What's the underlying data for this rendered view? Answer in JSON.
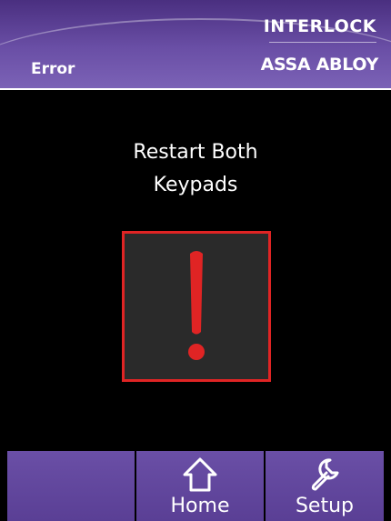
{
  "header": {
    "screen_title": "Error",
    "brand_top": "INTERLOCK",
    "brand_bottom": "ASSA ABLOY"
  },
  "message": {
    "line1": "Restart Both",
    "line2": "Keypads"
  },
  "alert": {
    "icon": "exclamation-icon",
    "border_color": "#e02424",
    "mark_color": "#e02424"
  },
  "nav": {
    "home_label": "Home",
    "home_icon": "home-icon",
    "setup_label": "Setup",
    "setup_icon": "wrench-icon"
  },
  "colors": {
    "header_purple": "#6a4fa6",
    "button_purple": "#5a3f95",
    "background": "#000000",
    "text": "#ffffff"
  }
}
